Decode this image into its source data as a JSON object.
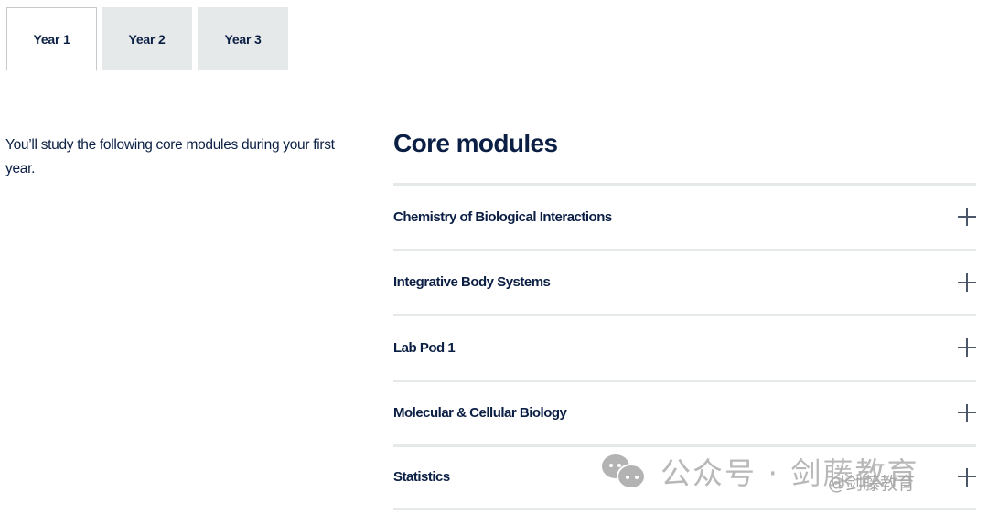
{
  "tabs": [
    {
      "label": "Year 1",
      "active": true
    },
    {
      "label": "Year 2",
      "active": false
    },
    {
      "label": "Year 3",
      "active": false
    }
  ],
  "intro": "You’ll study the following core modules during your first year.",
  "section": {
    "title": "Core modules",
    "modules": [
      {
        "title": "Chemistry of Biological Interactions",
        "icon": "plus-icon"
      },
      {
        "title": "Integrative Body Systems",
        "icon": "plus-icon"
      },
      {
        "title": "Lab Pod 1",
        "icon": "plus-icon"
      },
      {
        "title": "Molecular & Cellular Biology",
        "icon": "plus-icon"
      },
      {
        "title": "Statistics",
        "icon": "plus-icon"
      }
    ]
  },
  "watermark": {
    "text": "公众号 · 剑藤教育",
    "small": "@剑藤教育",
    "icon": "wechat-icon"
  },
  "colors": {
    "text": "#0b1f44",
    "tab_inactive_bg": "#e6e9ea",
    "divider": "#e6e9ea",
    "icon": "#4b5669"
  }
}
